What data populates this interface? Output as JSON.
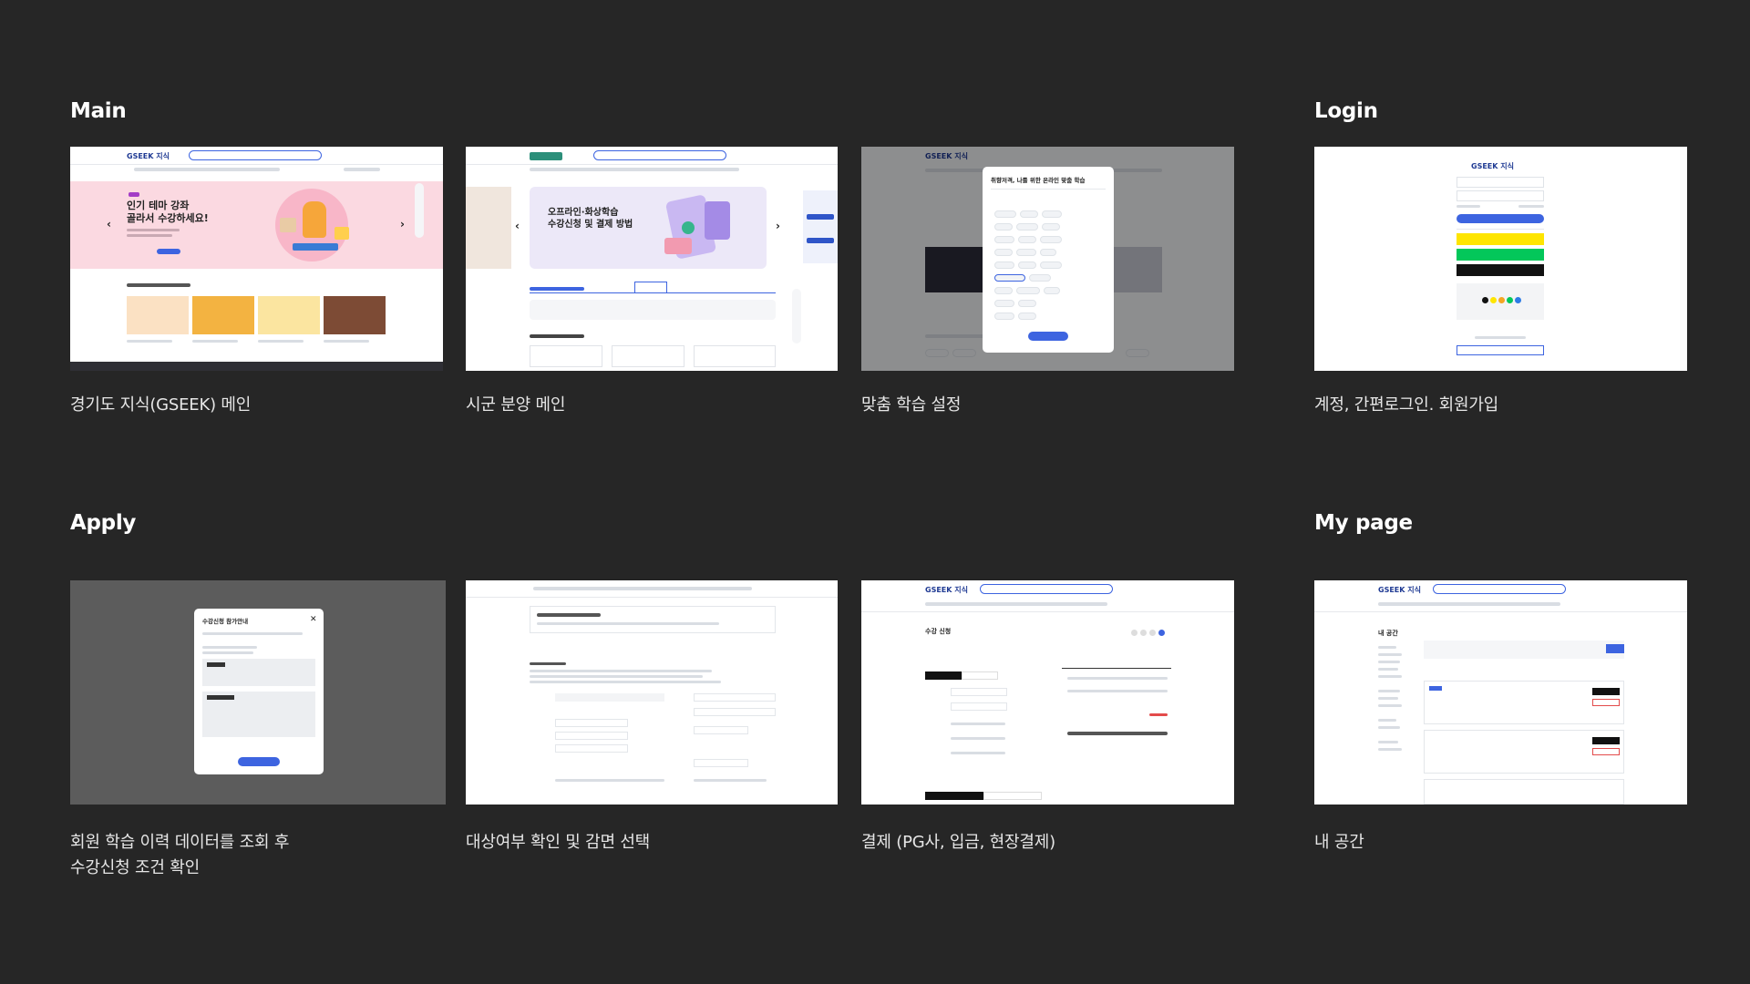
{
  "sections": {
    "main": "Main",
    "login": "Login",
    "apply": "Apply",
    "mypage": "My page"
  },
  "captions": {
    "c1": "경기도 지식(GSEEK) 메인",
    "c2": "시군 분양 메인",
    "c3": "맞춤 학습 설정",
    "c4": "계정, 간편로그인. 회원가입",
    "c5_line1": "회원 학습 이력 데이터를 조회 후",
    "c5_line2": "수강신청 조건 확인",
    "c6": "대상여부 확인 및 감면 선택",
    "c7": "결제 (PG사, 입금, 현장결제)",
    "c8": "내 공간"
  },
  "thumbs": {
    "main_hero_line1": "인기 테마 강좌",
    "main_hero_line2": "골라서 수강하세요!",
    "brand": "GSEEK 지식",
    "sigun_hero_line1": "오프라인·화상학습",
    "sigun_hero_line2": "수강신청 및 결제 방법",
    "custom_modal_title": "취향저격, 나를 위한 온라인 맞춤 학습",
    "apply_modal_title": "수강신청 참가안내",
    "pay_title": "수강 신청",
    "mypage_title": "내 공간"
  },
  "colors": {
    "background": "#262626",
    "accent_blue": "#3d64e0",
    "hero_pink": "#fbd9e1",
    "hero_lavender": "#ece8f8",
    "kakao_yellow": "#fee500",
    "naver_green": "#03c75a"
  }
}
